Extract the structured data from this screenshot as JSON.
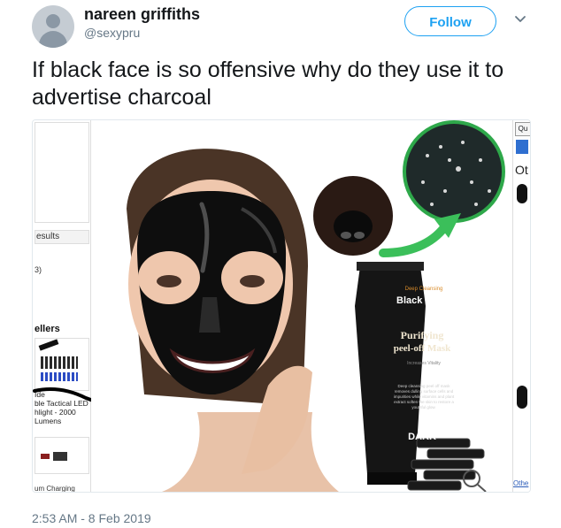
{
  "user": {
    "name": "nareen griffiths",
    "handle": "@sexypru"
  },
  "follow_label": "Follow",
  "tweet_text": "If black face is so offensive why do they use it to advertise charcoal",
  "left_panel": {
    "results": "esults",
    "count": "3)",
    "sellers": "ellers",
    "product_lines": [
      "Ide",
      "ble Tactical LED",
      "hlight - 2000",
      "Lumens"
    ],
    "bottom": "um Charging"
  },
  "right_panel": {
    "top": "Qu",
    "mid": "Ot",
    "bottom": "Othe"
  },
  "product": {
    "tag": "Deep Cleansing",
    "name": "Black Mask",
    "line1": "Purifying",
    "line2": "peel-off Mask",
    "small": "Increases Vitality",
    "desc": "Deep cleansing peel off mask removes dulling surface cells and impurities while vitamins and plant extract soften the skin to restore a youthful glow.",
    "variant": "DARK"
  },
  "timestamp": "2:53 AM - 8 Feb 2019",
  "colors": {
    "accent": "#1da1f2",
    "text": "#14171a",
    "muted": "#657786",
    "arrow": "#3bbf5a"
  }
}
